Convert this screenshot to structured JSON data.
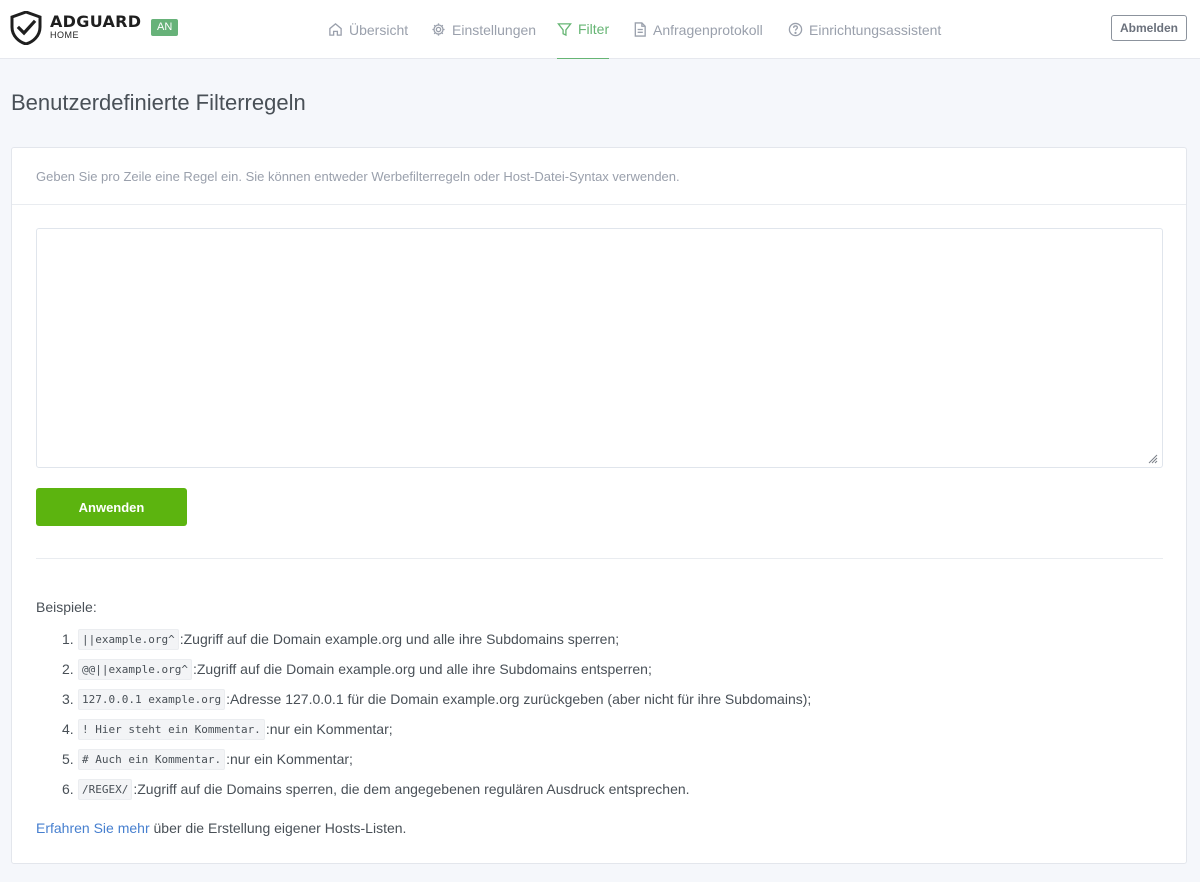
{
  "brand": {
    "name": "ADGUARD",
    "sub": "HOME",
    "status_badge": "AN"
  },
  "nav": [
    {
      "label": "Übersicht",
      "icon": "home-icon"
    },
    {
      "label": "Einstellungen",
      "icon": "gear-icon"
    },
    {
      "label": "Filter",
      "icon": "funnel-icon",
      "active": true
    },
    {
      "label": "Anfragenprotokoll",
      "icon": "document-icon"
    },
    {
      "label": "Einrichtungsassistent",
      "icon": "help-circle-icon"
    }
  ],
  "logout_label": "Abmelden",
  "page_title": "Benutzerdefinierte Filterregeln",
  "card": {
    "description": "Geben Sie pro Zeile eine Regel ein. Sie können entweder Werbefilterregeln oder Host-Datei-Syntax verwenden.",
    "textarea_value": "",
    "apply_label": "Anwenden",
    "examples_label": "Beispiele:",
    "examples": [
      {
        "num": "1.",
        "code": "||example.org^",
        "text": ":Zugriff auf die Domain example.org und alle ihre Subdomains sperren;"
      },
      {
        "num": "2.",
        "code": "@@||example.org^",
        "text": ":Zugriff auf die Domain example.org und alle ihre Subdomains entsperren;"
      },
      {
        "num": "3.",
        "code": "127.0.0.1 example.org",
        "text": ":Adresse 127.0.0.1 für die Domain example.org zurückgeben (aber nicht für ihre Subdomains);"
      },
      {
        "num": "4.",
        "code": "! Hier steht ein Kommentar.",
        "text": ":nur ein Kommentar;"
      },
      {
        "num": "5.",
        "code": "# Auch ein Kommentar.",
        "text": ":nur ein Kommentar;"
      },
      {
        "num": "6.",
        "code": "/REGEX/",
        "text": ":Zugriff auf die Domains sperren, die dem angegebenen regulären Ausdruck entsprechen."
      }
    ],
    "learn_more_link": "Erfahren Sie mehr",
    "learn_more_text": " über die Erstellung eigener Hosts-Listen."
  },
  "colors": {
    "accent": "#66b574",
    "apply_button": "#5cb40f",
    "link": "#467fcf",
    "badge": "#67b279"
  }
}
